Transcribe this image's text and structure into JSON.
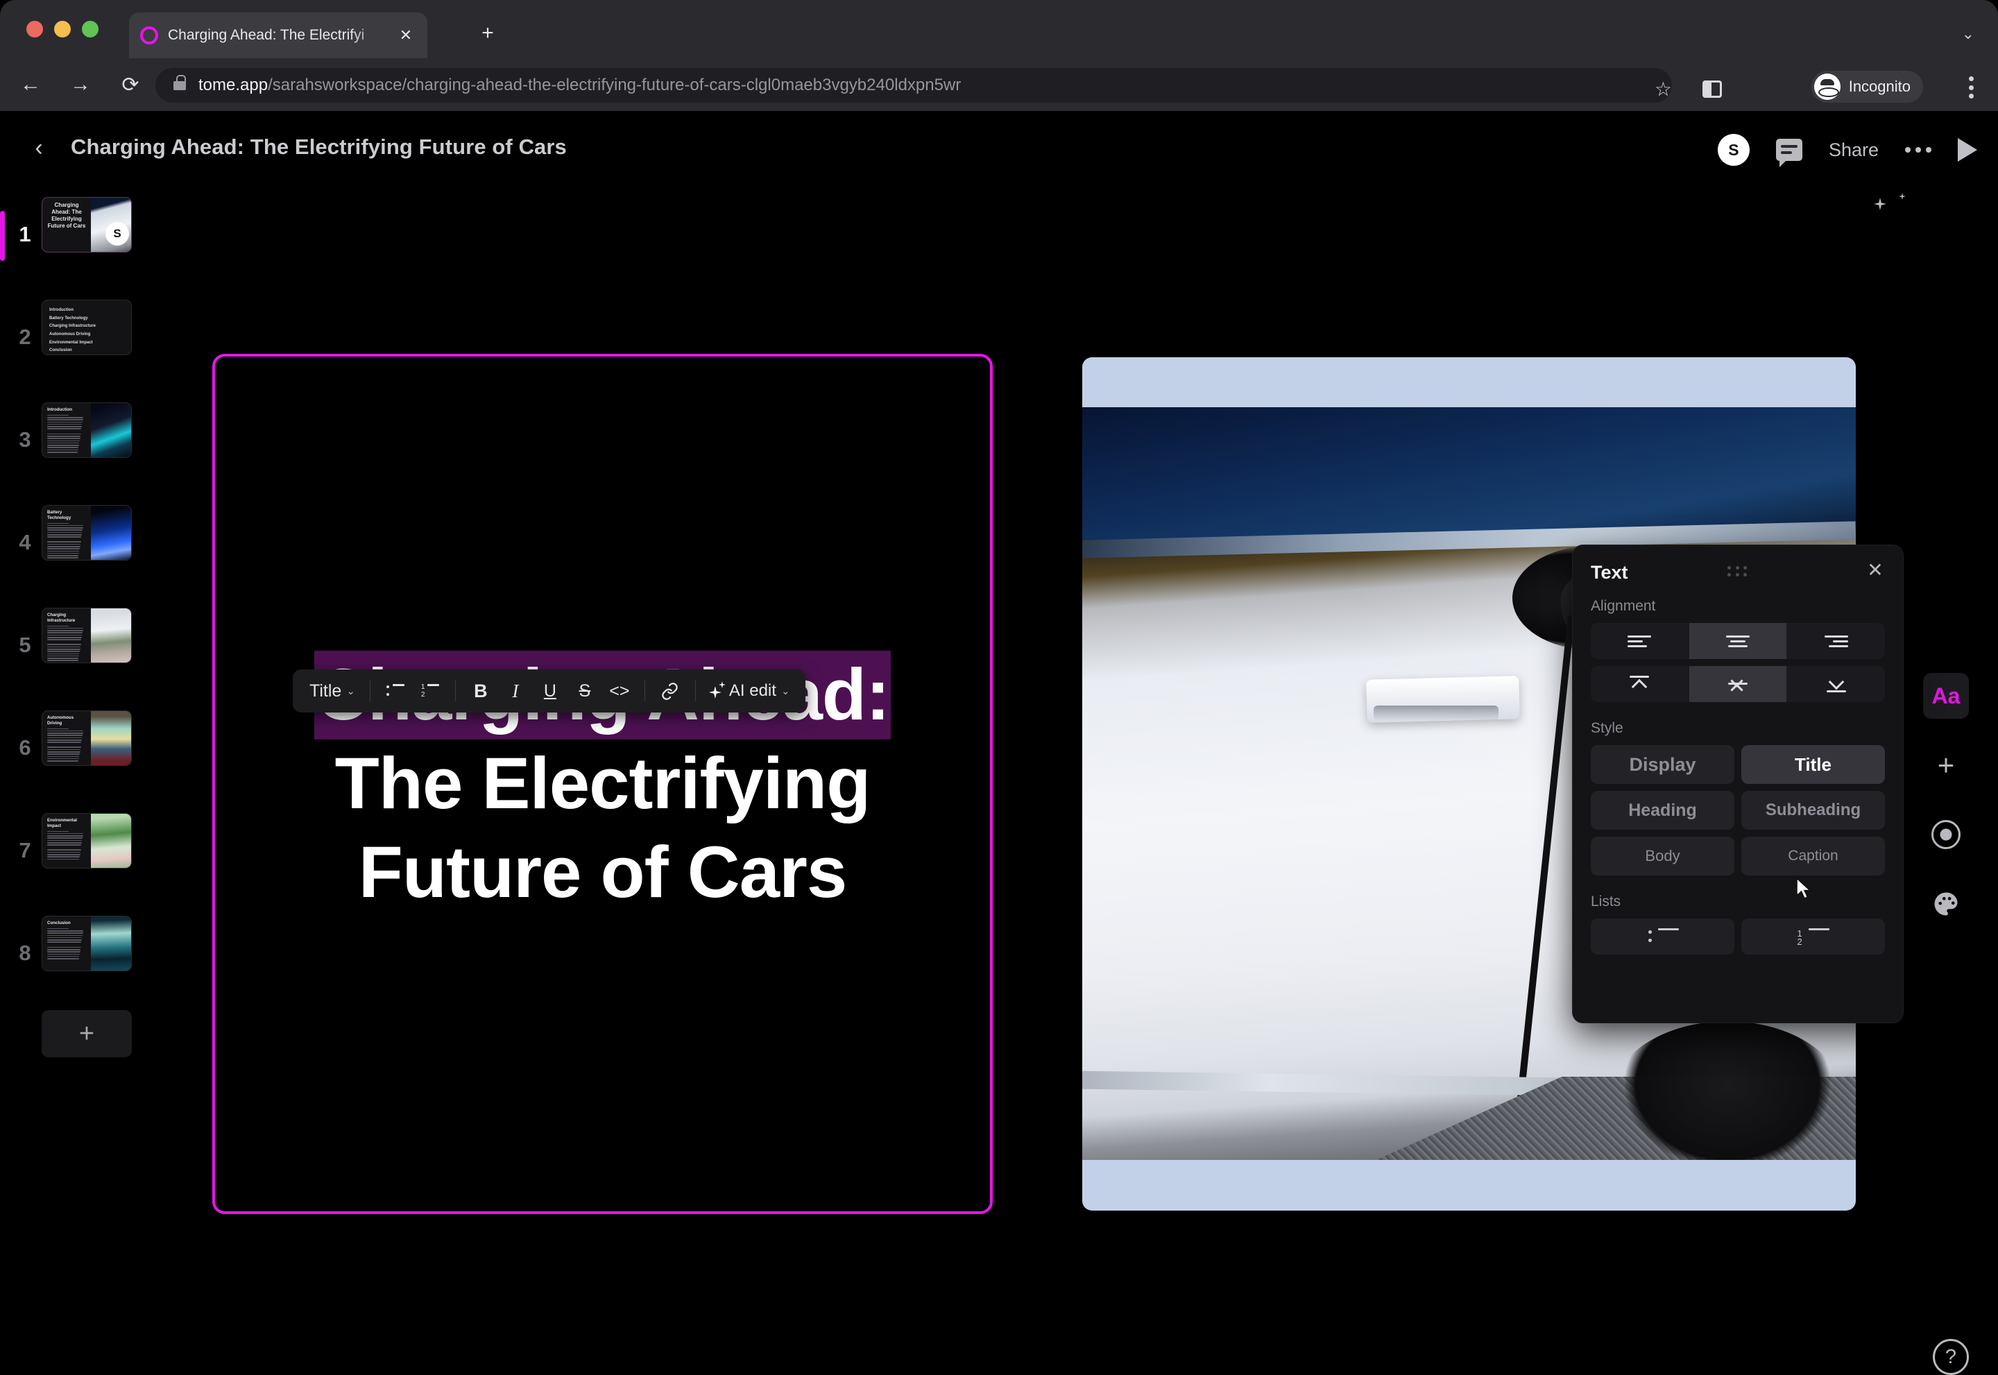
{
  "browser": {
    "tab": {
      "title": "Charging Ahead: The Electrifyi",
      "close_label": "✕",
      "favicon": "tome-logo-icon"
    },
    "new_tab_label": "+",
    "tab_list_label": "⌄",
    "nav": {
      "back": "←",
      "forward": "→",
      "reload": "⟳"
    },
    "omnibox": {
      "host": "tome.app",
      "path": "/sarahsworkspace/charging-ahead-the-electrifying-future-of-cars-clgl0maeb3vgyb240ldxpn5wr",
      "lock": "lock-icon",
      "star": "☆"
    },
    "profile": {
      "label": "Incognito"
    },
    "menu_label": "⋮"
  },
  "app": {
    "header": {
      "back": "‹",
      "title": "Charging Ahead: The Electrifying Future of Cars",
      "avatar_initial": "S",
      "share_label": "Share",
      "present_label": "play-icon",
      "more_label": "more-icon"
    },
    "slides": [
      {
        "num": "1",
        "title": "Charging Ahead: The Electrifying Future of Cars",
        "active": true,
        "avatar": "S",
        "layout": "title-image",
        "lines": 0
      },
      {
        "num": "2",
        "title": "",
        "active": false,
        "layout": "toc",
        "toc": [
          "Introduction",
          "Battery Technology",
          "Charging Infrastructure",
          "Autonomous Driving",
          "Environmental Impact",
          "Conclusion"
        ]
      },
      {
        "num": "3",
        "title": "Introduction",
        "active": false,
        "layout": "text-image",
        "lines": 16
      },
      {
        "num": "4",
        "title": "Battery Technology",
        "active": false,
        "layout": "text-image",
        "lines": 16
      },
      {
        "num": "5",
        "title": "Charging Infrastructure",
        "active": false,
        "layout": "text-image",
        "lines": 15
      },
      {
        "num": "6",
        "title": "Autonomous Driving",
        "active": false,
        "layout": "text-image",
        "lines": 14
      },
      {
        "num": "7",
        "title": "Environmental Impact",
        "active": false,
        "layout": "text-image",
        "lines": 12
      },
      {
        "num": "8",
        "title": "Conclusion",
        "active": false,
        "layout": "text-image",
        "lines": 13
      }
    ],
    "add_slide_label": "+",
    "canvas": {
      "title_lines": [
        "Charging Ahead:",
        "The Electrifying",
        "Future of Cars"
      ],
      "selected_line_index": 0,
      "selection_highlight_color": "#4d1152",
      "selected_card_border_color": "#e515e5",
      "image_card_background": "#c2d1e8"
    },
    "format_toolbar": {
      "style_label": "Title",
      "caret": "⌄",
      "bullet_list": "bulleted-list-icon",
      "numbered_list": "numbered-list-icon",
      "bold": "B",
      "italic": "I",
      "underline": "U",
      "strikethrough": "S",
      "code": "<>",
      "link": "🔗",
      "ai_edit_label": "AI edit"
    },
    "text_panel": {
      "title": "Text",
      "close": "✕",
      "alignment_label": "Alignment",
      "alignment_options": [
        {
          "name": "align-left",
          "active": false
        },
        {
          "name": "align-center",
          "active": true
        },
        {
          "name": "align-right",
          "active": false
        }
      ],
      "vertical_align_options": [
        {
          "name": "align-top",
          "active": false
        },
        {
          "name": "align-middle",
          "active": true
        },
        {
          "name": "align-bottom",
          "active": false
        }
      ],
      "style_label": "Style",
      "styles": [
        {
          "label": "Display",
          "active": false
        },
        {
          "label": "Title",
          "active": true
        },
        {
          "label": "Heading",
          "active": false
        },
        {
          "label": "Subheading",
          "active": false
        },
        {
          "label": "Body",
          "active": false
        },
        {
          "label": "Caption",
          "active": false
        }
      ],
      "lists_label": "Lists",
      "lists": [
        {
          "name": "bulleted-list",
          "marks": [
            "•",
            "•"
          ]
        },
        {
          "name": "numbered-list",
          "marks": [
            "1",
            "2"
          ]
        }
      ]
    },
    "right_rail": [
      {
        "name": "text-tool",
        "label": "Aa",
        "active": true
      },
      {
        "name": "add-tool",
        "label": "+",
        "active": false
      },
      {
        "name": "record-tool",
        "label": "record-icon",
        "active": false
      },
      {
        "name": "theme-tool",
        "label": "palette-icon",
        "active": false
      }
    ],
    "right_rail_bottom": [
      {
        "name": "ai-tool",
        "label": "sparkle-icon"
      },
      {
        "name": "help-button",
        "label": "?"
      }
    ]
  }
}
